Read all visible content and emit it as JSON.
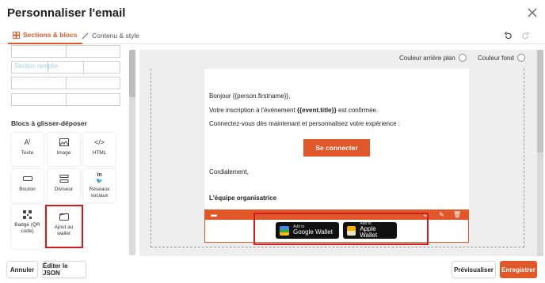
{
  "header": {
    "title": "Personnaliser l'email",
    "close_icon": "close-icon"
  },
  "tabs": [
    {
      "label": "Sections & blocs",
      "icon": "layout-grid-icon",
      "active": true
    },
    {
      "label": "Contenu & style",
      "icon": "brush-icon",
      "active": false
    }
  ],
  "sections": {
    "ghost_label": "Section remplie"
  },
  "blocks": {
    "title": "Blocs à glisser-déposer",
    "items": [
      {
        "label": "Texte",
        "icon": "text-icon"
      },
      {
        "label": "Image",
        "icon": "image-icon"
      },
      {
        "label": "HTML",
        "icon": "code-icon"
      },
      {
        "label": "Bouton",
        "icon": "button-icon"
      },
      {
        "label": "Diviseur",
        "icon": "divider-icon"
      },
      {
        "label": "Réseaux sociaux",
        "icon": "social-icon"
      },
      {
        "label": "Badge (QR code)",
        "icon": "qr-icon"
      },
      {
        "label": "Ajout au wallet",
        "icon": "wallet-icon"
      }
    ]
  },
  "canvas": {
    "bg_option_1": "Couleur arrière plan",
    "bg_option_2": "Couleur fond"
  },
  "email": {
    "greeting": "Bonjour {{person.firstname}},",
    "line2_pre": "Votre inscription à l'événement ",
    "line2_bold": "{{event.title}}",
    "line2_post": " est confirmée.",
    "line3": "Connectez-vous dès maintenant et personnalisez votre expérience :",
    "button": "Se connecter",
    "closing": "Cordialement,",
    "signature": "L'équipe organisatrice"
  },
  "wallet": {
    "google_small": "Add to",
    "google_big": "Google Wallet",
    "apple_small": "Add to",
    "apple_big": "Apple Wallet"
  },
  "footer": {
    "cancel": "Annuler",
    "edit_json": "Éditer le JSON",
    "preview": "Prévisualiser",
    "save": "Enregistrer"
  },
  "colors": {
    "accent": "#e0582a",
    "highlight": "#d01c1c"
  }
}
